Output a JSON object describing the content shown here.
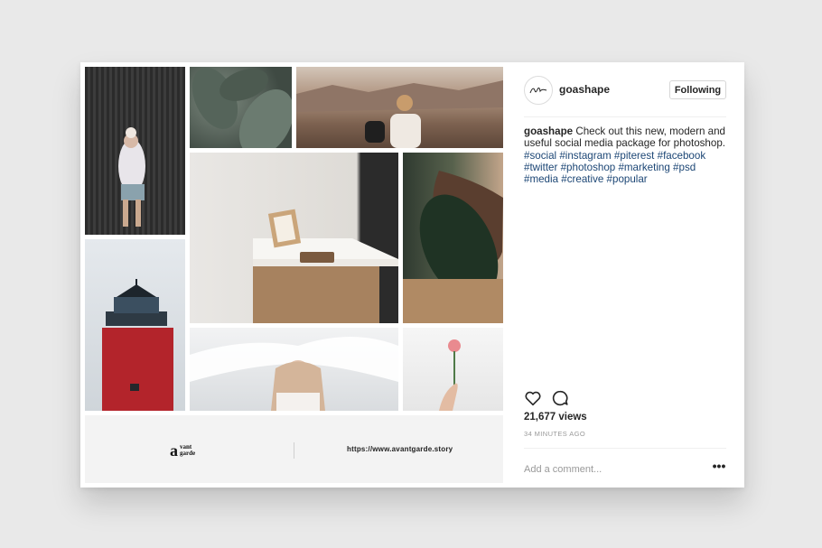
{
  "post": {
    "username": "goashape",
    "follow_label": "Following",
    "caption": {
      "user": "goashape",
      "text": "Check out this new, modern and useful social media package for photoshop.",
      "hashtags": [
        "#social",
        "#instagram",
        "#piterest",
        "#facebook",
        "#twitter",
        "#photoshop",
        "#marketing",
        "#psd",
        "#media",
        "#creative",
        "#popular"
      ]
    },
    "views": "21,677 views",
    "time_ago": "34 MINUTES AGO",
    "comment_placeholder": "Add a comment...",
    "more_label": "•••"
  },
  "collage": {
    "footer": {
      "logo_mark": "a",
      "logo_words": [
        "vant",
        "garde"
      ],
      "url": "https://www.avantgarde.story"
    }
  },
  "colors": {
    "background": "#e9e9e9",
    "card": "#ffffff",
    "hashtag": "#1c4675",
    "text": "#262626",
    "muted": "#999999"
  },
  "icons": [
    "heart-icon",
    "comment-icon"
  ]
}
